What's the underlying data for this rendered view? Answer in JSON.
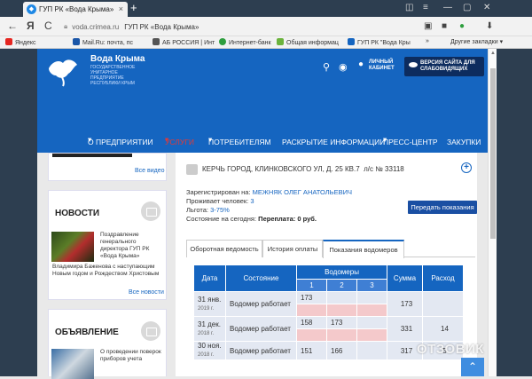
{
  "browser": {
    "tab_title": "ГУП РК «Вода Крыма»",
    "tab_close": "×",
    "new_tab": "+",
    "url_domain": "voda.crimea.ru",
    "url_title": "ГУП РК «Вода Крыма»",
    "back_glyph": "←",
    "forward_glyph": "Я",
    "reload_glyph": "C",
    "bookmarks": [
      {
        "label": "Яндекс",
        "icon": "yandex-icon",
        "color": "#e52620"
      },
      {
        "label": "Mail.Ru: почта, пс",
        "icon": "mailru-icon",
        "color": "#1a56a8"
      },
      {
        "label": "АБ РОССИЯ | Инт",
        "icon": "bank-icon",
        "color": "#555555"
      },
      {
        "label": "Интернет-банк",
        "icon": "bank2-icon",
        "color": "#2e9e3e"
      },
      {
        "label": "Общая информац",
        "icon": "leaf-icon",
        "color": "#6bb33d"
      },
      {
        "label": "ГУП РК \"Вода Кры",
        "icon": "vodakryma-icon",
        "color": "#1565c0"
      }
    ],
    "bookmarks_more": "»",
    "other_bookmarks": "Другие закладки"
  },
  "site": {
    "logo_title": "Вода Крыма",
    "logo_subtitle": "Государственное унитарное предприятие Республики Крым",
    "cabinet_label": "Личный кабинет",
    "a11y_label": "Версия сайта для слабовидящих",
    "nav": [
      "О предприятии",
      "Услуги",
      "Потребителям",
      "Раскрытие информации",
      "Пресс-центр",
      "Закупки"
    ],
    "nav_active_color": "#e53935"
  },
  "sidebar": {
    "all_video": "Все видео",
    "news_title": "Новости",
    "news_item": "Поздравление генерального директора ГУП РК «Вода Крыма»",
    "news_item_cont": "Владимира Баженова с наступающим Новым годом и Рождеством Христовым",
    "all_news": "Все новости",
    "ads_title": "Объявление",
    "ad_item": "О проведении поверок приборов учета"
  },
  "account": {
    "address": "Керчь город, Клинковского ул, д. 25 кв.7",
    "account_number": "л/с № 33118",
    "registered_label": "Зарегистрирован на:",
    "registered_value": "МЕЖНЯК ОЛЕГ АНАТОЛЬЕВИЧ",
    "residents_label": "Проживает человек:",
    "residents_value": "3",
    "benefit_label": "Льгота:",
    "benefit_value": "3-75%",
    "balance_label": "Состояние на сегодня:",
    "balance_value": "Переплата: 0 руб.",
    "submit_button": "Передать показания"
  },
  "tabs": [
    "Оборотная ведомость",
    "История оплаты",
    "Показания водомеров"
  ],
  "active_tab": 2,
  "meters_table": {
    "headers": {
      "date": "Дата",
      "state": "Состояние",
      "meters": "Водомеры",
      "sum": "Сумма",
      "flow": "Расход"
    },
    "meter_cols": [
      "1",
      "2",
      "3"
    ],
    "rows": [
      {
        "day": "31 янв.",
        "year": "2019 г.",
        "state": "Водомер работает",
        "m1": "173",
        "m2": "",
        "m3": "",
        "sum": "173",
        "flow": ""
      },
      {
        "day": "31 дек.",
        "year": "2018 г.",
        "state": "Водомер работает",
        "m1": "158",
        "m2": "173",
        "m3": "",
        "sum": "331",
        "flow": "14"
      },
      {
        "day": "30 ноя.",
        "year": "2018 г.",
        "state": "Водомер работает",
        "m1": "151",
        "m2": "166",
        "m3": "",
        "sum": "317",
        "flow": "5"
      }
    ]
  },
  "overlay": {
    "watermark": "ОТЗОВИК",
    "scroll_up": "⌃"
  }
}
